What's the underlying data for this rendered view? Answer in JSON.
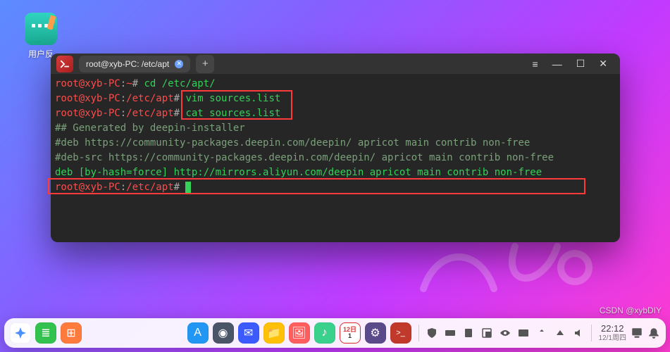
{
  "desktop": {
    "icon_label": "用户反"
  },
  "window": {
    "tab_title": "root@xyb-PC: /etc/apt",
    "new_tab": "+",
    "controls": {
      "menu": "≡",
      "min": "—",
      "max": "☐",
      "close": "✕"
    }
  },
  "terminal": {
    "lines": [
      {
        "prompt": "root@xyb-PC",
        "sep": ":",
        "path": "~",
        "hash": "# ",
        "cmd": "cd /etc/apt/"
      },
      {
        "prompt": "root@xyb-PC",
        "sep": ":",
        "path": "/etc/apt",
        "hash": "# ",
        "cmd": "vim sources.list"
      },
      {
        "prompt": "root@xyb-PC",
        "sep": ":",
        "path": "/etc/apt",
        "hash": "# ",
        "cmd": "cat sources.list"
      },
      {
        "text": "## Generated by deepin-installer"
      },
      {
        "text": "#deb https://community-packages.deepin.com/deepin/ apricot main contrib non-free"
      },
      {
        "text": "#deb-src https://community-packages.deepin.com/deepin/ apricot main contrib non-free"
      },
      {
        "text": "deb [by-hash=force] http://mirrors.aliyun.com/deepin apricot main contrib non-free"
      },
      {
        "prompt": "root@xyb-PC",
        "sep": ":",
        "path": "/etc/apt",
        "hash": "# ",
        "cursor": true
      }
    ]
  },
  "dock": {
    "calendar": {
      "month": "12日",
      "day": "1"
    },
    "clock": {
      "time": "22:12",
      "date": "12/1周四"
    },
    "items": [
      {
        "name": "launcher",
        "bg": "#ffffff",
        "glyph": "✦",
        "color": "#4a90ff"
      },
      {
        "name": "multitask",
        "bg": "#32c24d",
        "glyph": "≣"
      },
      {
        "name": "grid",
        "bg": "#ff7a3d",
        "glyph": "⊞"
      }
    ],
    "center": [
      {
        "name": "app-store",
        "bg": "#2196f3",
        "glyph": "A"
      },
      {
        "name": "browser",
        "bg": "#4a5568",
        "glyph": "◉"
      },
      {
        "name": "mail",
        "bg": "#3b5bff",
        "glyph": "✉"
      },
      {
        "name": "files",
        "bg": "#ffc107",
        "glyph": "📁"
      },
      {
        "name": "photos",
        "bg": "#ff5e5e",
        "glyph": "🖼"
      },
      {
        "name": "music",
        "bg": "#3ad18c",
        "glyph": "♪"
      },
      {
        "name": "calendar",
        "bg": "#ffffff"
      },
      {
        "name": "settings",
        "bg": "#5a4a8a",
        "glyph": "⚙"
      },
      {
        "name": "terminal",
        "bg": "#c0392b",
        "glyph": ">_"
      }
    ]
  },
  "watermark": "CSDN @xybDIY"
}
